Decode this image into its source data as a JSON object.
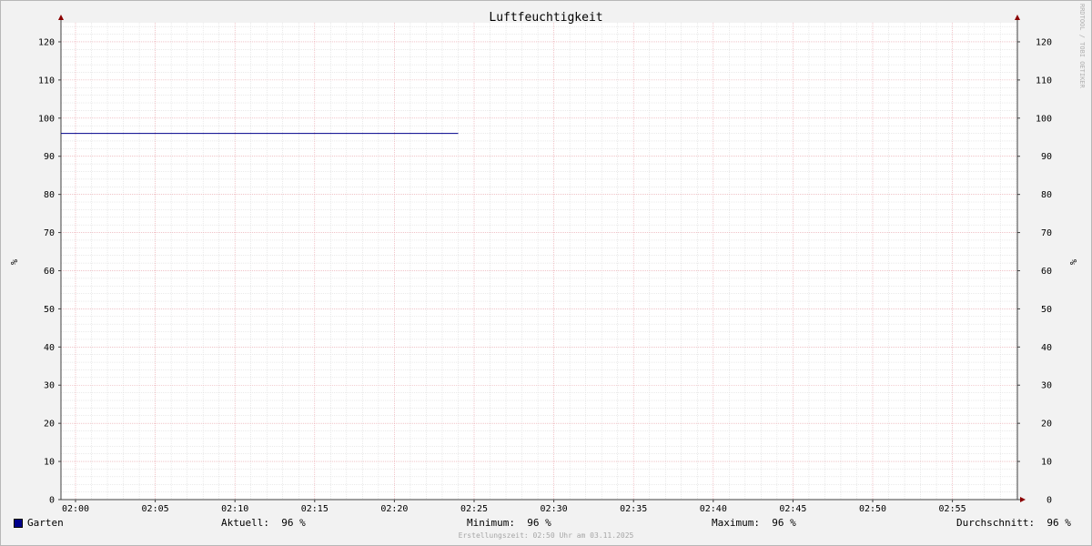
{
  "chart_data": {
    "type": "line",
    "title": "Luftfeuchtigkeit",
    "ylabel": "%",
    "ylabel_right": "%",
    "ylim": [
      0,
      125
    ],
    "y_ticks": [
      0,
      10,
      20,
      30,
      40,
      50,
      60,
      70,
      80,
      90,
      100,
      110,
      120
    ],
    "x_range": [
      "02:00",
      "03:00"
    ],
    "x_ticks": [
      "02:00",
      "02:05",
      "02:10",
      "02:15",
      "02:20",
      "02:25",
      "02:30",
      "02:35",
      "02:40",
      "02:45",
      "02:50",
      "02:55"
    ],
    "grid": true,
    "series": [
      {
        "name": "Garten",
        "color": "#00008b",
        "x": [
          "01:59",
          "02:24"
        ],
        "values": [
          96,
          96
        ]
      }
    ]
  },
  "legend": {
    "series_name": "Garten",
    "swatch_color": "#00008b",
    "current_label": "Aktuell:",
    "current_value": "96 %",
    "min_label": "Minimum:",
    "min_value": "96 %",
    "max_label": "Maximum:",
    "max_value": "96 %",
    "avg_label": "Durchschnitt:",
    "avg_value": "96 %"
  },
  "watermark": "RRDTOOL / TOBI OETIKER",
  "footer": "Erstellungszeit: 02:50 Uhr am 03.11.2025",
  "colors": {
    "background": "#f2f2f2",
    "plot_background": "#ffffff",
    "major_grid": "#e8a0a8",
    "minor_grid": "#d6d6d6",
    "axis": "#404040",
    "arrow": "#8b0000"
  }
}
